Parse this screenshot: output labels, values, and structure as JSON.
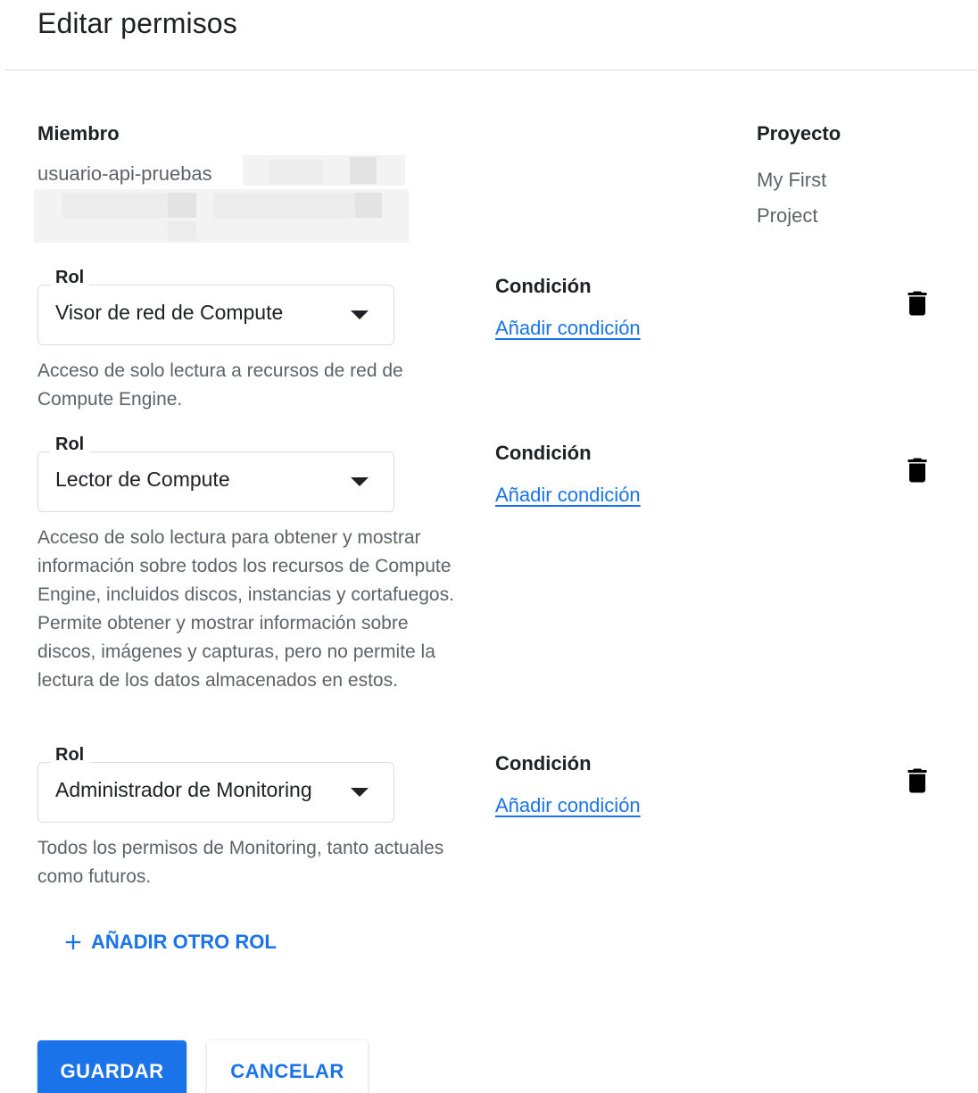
{
  "dialog": {
    "title": "Editar permisos"
  },
  "member": {
    "label": "Miembro",
    "value": "usuario-api-pruebas"
  },
  "project": {
    "label": "Proyecto",
    "value": "My First Project"
  },
  "roles": [
    {
      "legend": "Rol",
      "selected": "Visor de red de Compute",
      "description": "Acceso de solo lectura a recursos de red de Compute Engine.",
      "condition_label": "Condición",
      "condition_link": "Añadir condición",
      "icon": "trash-icon"
    },
    {
      "legend": "Rol",
      "selected": "Lector de Compute",
      "description": "Acceso de solo lectura para obtener y mostrar información sobre todos los recursos de Compute Engine, incluidos discos, instancias y cortafuegos. Permite obtener y mostrar información sobre discos, imágenes y capturas, pero no permite la lectura de los datos almacenados en estos.",
      "condition_label": "Condición",
      "condition_link": "Añadir condición",
      "icon": "trash-icon"
    },
    {
      "legend": "Rol",
      "selected": "Administrador de Monitoring",
      "description": "Todos los permisos de Monitoring, tanto actuales como futuros.",
      "condition_label": "Condición",
      "condition_link": "Añadir condición",
      "icon": "trash-icon"
    }
  ],
  "add_role": {
    "label": "AÑADIR OTRO ROL",
    "icon": "plus-icon"
  },
  "actions": {
    "save": "GUARDAR",
    "cancel": "CANCELAR"
  },
  "colors": {
    "primary": "#1a73e8",
    "text": "#202124",
    "secondary_text": "#5f6368",
    "border": "#dadce0"
  }
}
